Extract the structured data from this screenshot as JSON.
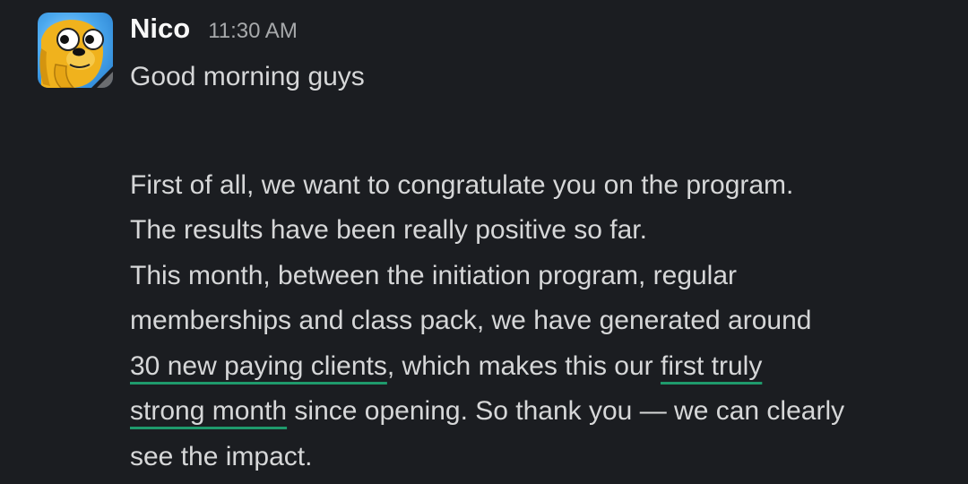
{
  "message": {
    "author": "Nico",
    "timestamp": "11:30 AM",
    "greeting": "Good morning guys",
    "lines": [
      "First of all, we want to congratulate you on the program.",
      "The results have been really positive so far.",
      "This month, between the initiation program, regular",
      "memberships and class pack, we have generated around"
    ],
    "line5": {
      "highlight1": "30 new paying clients",
      "text": ", which makes this our ",
      "highlight2a": "first truly"
    },
    "line6": {
      "highlight2b": "strong month",
      "text": " since opening. So thank you — we can clearly"
    },
    "line7": "see the impact."
  },
  "avatar": {
    "icon": "jake-the-dog-avatar-icon",
    "bg_color": "#3a9ee6",
    "face_color": "#f0b21d"
  },
  "colors": {
    "background": "#1b1d21",
    "underline": "#1f9a6c"
  }
}
